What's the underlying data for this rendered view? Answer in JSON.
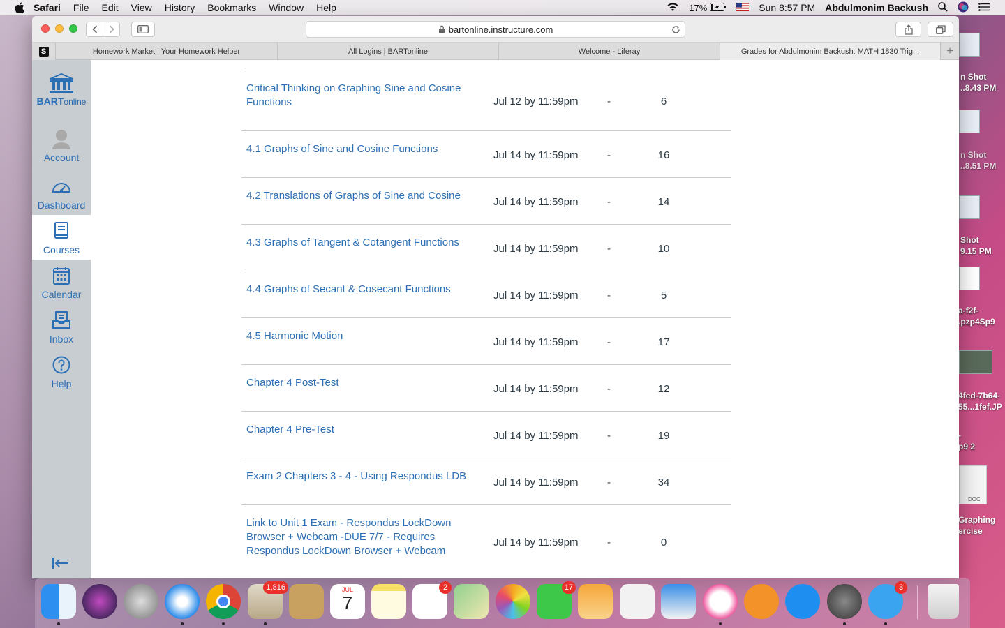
{
  "menubar": {
    "app": "Safari",
    "items": [
      "File",
      "Edit",
      "View",
      "History",
      "Bookmarks",
      "Window",
      "Help"
    ],
    "battery": "17%",
    "clock": "Sun 8:57 PM",
    "user": "Abdulmonim Backush"
  },
  "browser": {
    "url": "bartonline.instructure.com",
    "tabs": [
      {
        "label": "Homework Market | Your Homework Helper"
      },
      {
        "label": "All Logins | BARTonline"
      },
      {
        "label": "Welcome - Liferay"
      },
      {
        "label": "Grades for Abdulmonim Backush: MATH 1830 Trig..."
      }
    ]
  },
  "gnav": {
    "logo_bold": "BART",
    "logo_rest": "online",
    "items": [
      {
        "label": "Account",
        "icon": "account-icon"
      },
      {
        "label": "Dashboard",
        "icon": "dashboard-icon"
      },
      {
        "label": "Courses",
        "icon": "courses-icon"
      },
      {
        "label": "Calendar",
        "icon": "calendar-icon"
      },
      {
        "label": "Inbox",
        "icon": "inbox-icon"
      },
      {
        "label": "Help",
        "icon": "help-icon"
      }
    ],
    "active": "Courses"
  },
  "assignments": [
    {
      "title": "Critical Thinking on Graphing Sine and Cosine Functions",
      "due": "Jul 12 by 11:59pm",
      "score": "-",
      "out_of": "6"
    },
    {
      "title": "4.1 Graphs of Sine and Cosine Functions",
      "due": "Jul 14 by 11:59pm",
      "score": "-",
      "out_of": "16"
    },
    {
      "title": "4.2 Translations of Graphs of Sine and Cosine",
      "due": "Jul 14 by 11:59pm",
      "score": "-",
      "out_of": "14"
    },
    {
      "title": "4.3 Graphs of Tangent & Cotangent Functions",
      "due": "Jul 14 by 11:59pm",
      "score": "-",
      "out_of": "10"
    },
    {
      "title": "4.4 Graphs of Secant & Cosecant Functions",
      "due": "Jul 14 by 11:59pm",
      "score": "-",
      "out_of": "5"
    },
    {
      "title": "4.5 Harmonic Motion",
      "due": "Jul 14 by 11:59pm",
      "score": "-",
      "out_of": "17"
    },
    {
      "title": "Chapter 4 Post-Test",
      "due": "Jul 14 by 11:59pm",
      "score": "-",
      "out_of": "12"
    },
    {
      "title": "Chapter 4 Pre-Test",
      "due": "Jul 14 by 11:59pm",
      "score": "-",
      "out_of": "19"
    },
    {
      "title": "Exam 2 Chapters 3 - 4 - Using Respondus LDB",
      "due": "Jul 14 by 11:59pm",
      "score": "-",
      "out_of": "34"
    },
    {
      "title": "Link to Unit 1 Exam - Respondus LockDown Browser + Webcam -DUE 7/7 - Requires Respondus LockDown Browser + Webcam",
      "due": "Jul 14 by 11:59pm",
      "score": "-",
      "out_of": "0"
    }
  ],
  "desktop": {
    "items": [
      {
        "label": "n Shot\n..8.43 PM"
      },
      {
        "label": "n Shot\n..8.51 PM"
      },
      {
        "label": "Shot\n9.15 PM"
      },
      {
        "label": "a-f2f-\n.pzp4Sp9"
      },
      {
        "label": "4fed-7b64-\n55...1fef.JP"
      },
      {
        "label": "-\np9 2"
      },
      {
        "label": "Graphing\nercise"
      }
    ],
    "doc_label": "DOC"
  },
  "dock": {
    "badges": {
      "mail": "1,816",
      "calendar_month": "JUL",
      "calendar_day": "7",
      "reminders": "2",
      "facetime": "17",
      "messages": "3"
    }
  }
}
